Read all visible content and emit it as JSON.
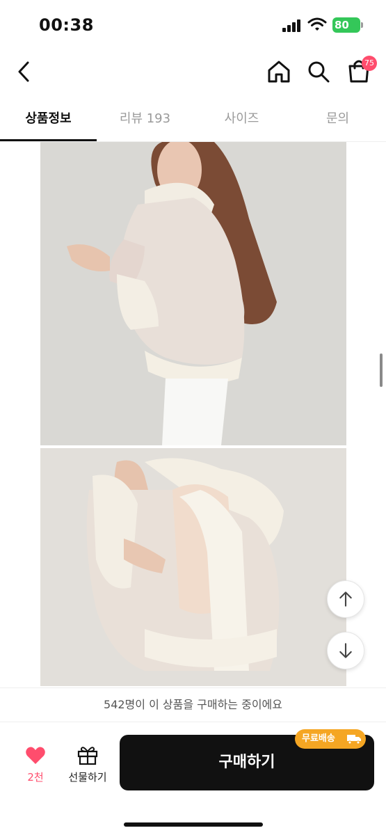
{
  "status_bar": {
    "time": "00:38",
    "battery": "80",
    "battery_color": "#34c759"
  },
  "header": {
    "back_icon": "chevron-left-icon",
    "home_icon": "home-icon",
    "search_icon": "search-icon",
    "cart_icon": "shopping-bag-icon",
    "cart_count": "75",
    "badge_color": "#ff4d6d"
  },
  "tabs": [
    {
      "label": "상품정보",
      "active": true
    },
    {
      "label": "리뷰 193",
      "active": false
    },
    {
      "label": "사이즈",
      "active": false
    },
    {
      "label": "문의",
      "active": false
    }
  ],
  "scroll_buttons": {
    "up_icon": "arrow-up-icon",
    "down_icon": "arrow-down-icon"
  },
  "purchasing_notice": "542명이 이 상품을 구매하는 중이에요",
  "bottom_bar": {
    "like_icon": "heart-icon",
    "like_count": "2천",
    "gift_icon": "gift-icon",
    "gift_label": "선물하기",
    "buy_label": "구매하기",
    "free_shipping_label": "무료배송",
    "shipping_icon": "truck-icon",
    "buy_color": "#111111",
    "shipping_color": "#f5a623"
  }
}
